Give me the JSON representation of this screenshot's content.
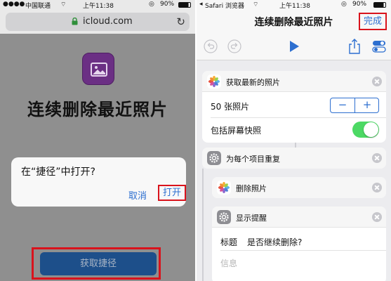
{
  "left": {
    "status": {
      "carrier": "中国联通",
      "time": "上午11:38",
      "battery": "90%"
    },
    "address": {
      "url": "icloud.com"
    },
    "app_title": "连续删除最近照片",
    "dialog": {
      "question": "在“捷径”中打开?",
      "cancel": "取消",
      "open": "打开"
    },
    "get_button": "获取捷径"
  },
  "right": {
    "status": {
      "carrier": "Safari 浏览器",
      "time": "上午11:38",
      "battery": "90%"
    },
    "nav": {
      "title": "连续删除最近照片",
      "done": "完成"
    },
    "actions": {
      "get_photos": {
        "title": "获取最新的照片",
        "count": "50 张照片",
        "include_screenshots": "包括屏幕快照",
        "minus": "−",
        "plus": "+"
      },
      "repeat": {
        "title": "为每个项目重复"
      },
      "delete": {
        "title": "删除照片"
      },
      "alert": {
        "title": "显示提醒",
        "field_label": "标题",
        "field_value": "是否继续删除?",
        "message_placeholder": "信息"
      }
    }
  },
  "colors": {
    "accent": "#2d6fd0",
    "highlight": "#d9131c",
    "toggle_on": "#4cd964",
    "app_icon": "#6b2f84"
  }
}
